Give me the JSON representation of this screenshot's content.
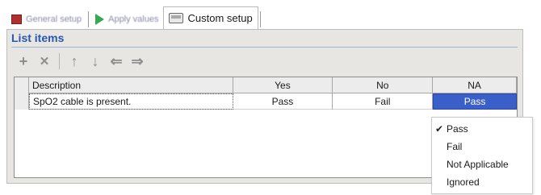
{
  "tabs": [
    {
      "label": "General setup",
      "icon": "record-icon",
      "active": false
    },
    {
      "label": "Apply values",
      "icon": "play-icon",
      "active": false
    },
    {
      "label": "Custom setup",
      "icon": "monitor-icon",
      "active": true
    }
  ],
  "panel": {
    "title": "List items",
    "toolbar": {
      "add": "+",
      "remove": "✕",
      "up": "↑",
      "down": "↓",
      "left": "⇐",
      "right": "⇒"
    }
  },
  "grid": {
    "columns": [
      "Description",
      "Yes",
      "No",
      "NA"
    ],
    "rows": [
      {
        "description": "SpO2 cable is present.",
        "yes": "Pass",
        "no": "Fail",
        "na": "Pass"
      }
    ]
  },
  "dropdown": {
    "selected": "Pass",
    "options": [
      "Pass",
      "Fail",
      "Not Applicable",
      "Ignored"
    ],
    "check": "✔"
  },
  "colors": {
    "title": "#2856b4",
    "selection": "#3a5fc8",
    "panel_bg": "#e7e6e2"
  }
}
